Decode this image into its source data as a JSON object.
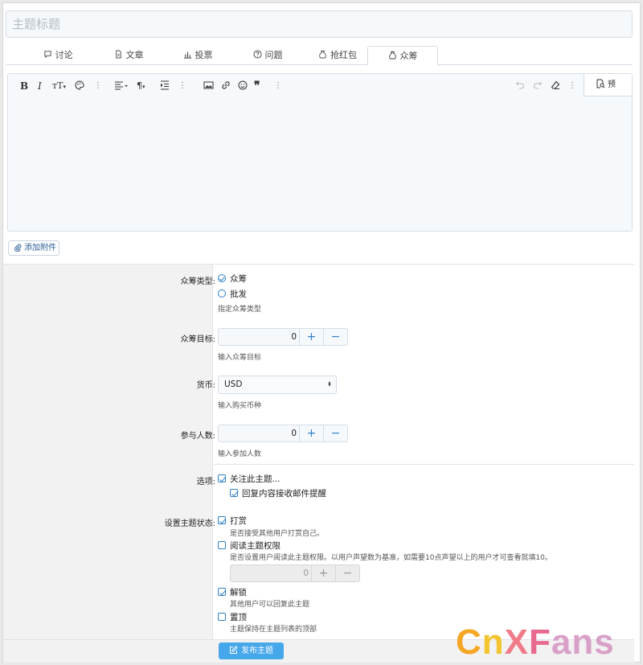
{
  "title_placeholder": "主题标题",
  "tabs": [
    {
      "label": "讨论",
      "icon": "chat-icon"
    },
    {
      "label": "文章",
      "icon": "document-icon"
    },
    {
      "label": "投票",
      "icon": "bar-chart-icon"
    },
    {
      "label": "问题",
      "icon": "question-icon"
    },
    {
      "label": "抢红包",
      "icon": "money-bag-icon"
    },
    {
      "label": "众筹",
      "icon": "money-bag-icon",
      "active": true
    }
  ],
  "editor": {
    "toolbar_icons": [
      "bold-icon",
      "italic-icon",
      "text-size-icon",
      "palette-icon",
      "more-icon",
      "align-icon",
      "paragraph-icon",
      "indent-icon",
      "more-icon",
      "image-icon",
      "link-icon",
      "emoji-icon",
      "quote-icon",
      "more-icon",
      "undo-icon",
      "redo-icon",
      "eraser-icon",
      "more-icon"
    ],
    "preview_label": "预"
  },
  "attach_label": "添加附件",
  "form": {
    "crowdfund_type_label": "众筹类型:",
    "type_options": [
      "众筹",
      "批发"
    ],
    "type_selected": "众筹",
    "type_hint": "指定众筹类型",
    "target_label": "众筹目标:",
    "target_value": "0",
    "target_hint": "输入众筹目标",
    "currency_label": "货币:",
    "currency_value": "USD",
    "currency_hint": "输入购买币种",
    "participants_label": "参与人数:",
    "participants_value": "0",
    "participants_hint": "输入参加人数",
    "options_label": "选项:",
    "watch_label": "关注此主题...",
    "email_label": "回复内容接收邮件提醒",
    "status_label": "设置主题状态:",
    "reward_label": "打赏",
    "reward_hint": "是否接受其他用户打赏自己。",
    "read_perm_label": "阅读主题权限",
    "read_perm_hint": "是否设置用户阅读此主题权限。以用户声望数为基准，如需要10点声望以上的用户才可查看就填10。",
    "read_perm_value": "0",
    "unlock_label": "解锁",
    "unlock_hint": "其他用户可以回复此主题",
    "sticky_label": "置顶",
    "sticky_hint": "主题保持在主题列表的顶部"
  },
  "submit_label": "发布主题",
  "stepper_plus": "+",
  "stepper_minus": "−",
  "watermark": {
    "c1": "C",
    "c2": "n",
    "c3": "X",
    "c4": "F",
    "c5": "ans"
  },
  "colors": {
    "accent": "#2f7fc8",
    "submit": "#47a7eb"
  }
}
